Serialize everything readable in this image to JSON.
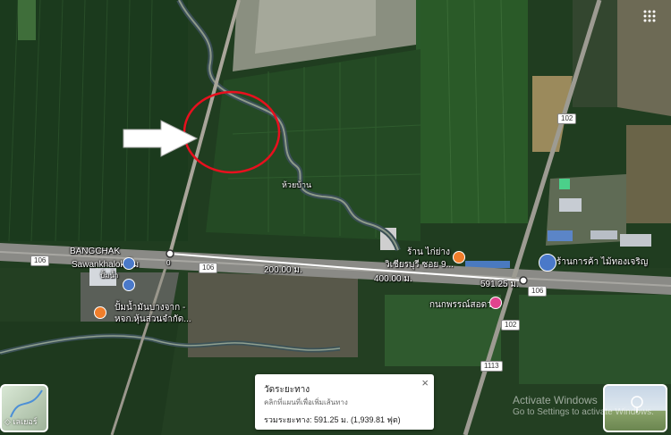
{
  "map": {
    "type": "satellite",
    "places": {
      "bangchak": "BANGCHAK",
      "sawankhalok": "Sawankhalok ปั้ม",
      "pump_sub": "ปั้มน้ำ",
      "fuel_station": "ปั้มน้ำมันบางจาก -",
      "fuel_station_2": "หจก.หุ้นส่วนจำกัด...",
      "restaurant": "ร้าน ไก่ย่าง",
      "restaurant_2": "วิเชียรบุรี ซอย 9...",
      "store": "ร้านการค้า ไม้ทองเจริญ",
      "kpn": "กนกพรรณ์สอดวง",
      "ditch": "ห้วยบ้าน"
    },
    "roads": {
      "shield_106_left": "106",
      "shield_106_mid": "106",
      "shield_106_right": "106",
      "shield_102_top": "102",
      "shield_102_bottom": "102",
      "shield_1113": "1113"
    },
    "measure_marks": {
      "m0": "0",
      "m200": "200.00 ม.",
      "m400": "400.00 ม.",
      "m591": "591.25 ม."
    }
  },
  "measure_panel": {
    "title": "วัดระยะทาง",
    "hint": "คลิกที่แผนที่เพื่อเพิ่มเส้นทาง",
    "total": "รวมระยะทาง: 591.25 ม. (1,939.81 ฟุต)",
    "close": "×"
  },
  "controls": {
    "apps": "⋮⋮⋮",
    "layers_label": "เลเยอร์"
  },
  "watermark": {
    "line1": "Activate Windows",
    "line2": "Go to Settings to activate Windows."
  },
  "colors": {
    "annotation_circle": "#e8101e",
    "arrow": "#ffffff"
  }
}
